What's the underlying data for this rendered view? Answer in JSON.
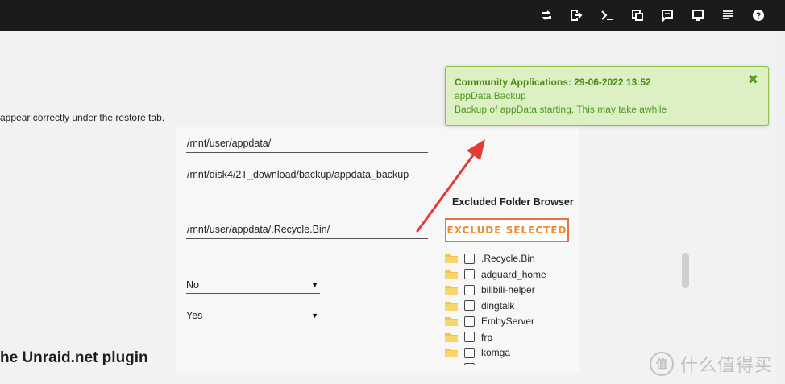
{
  "topbar": {
    "icons": [
      {
        "name": "swap-icon"
      },
      {
        "name": "logout-icon"
      },
      {
        "name": "terminal-icon"
      },
      {
        "name": "copy-icon"
      },
      {
        "name": "feedback-icon"
      },
      {
        "name": "monitor-icon"
      },
      {
        "name": "log-icon"
      },
      {
        "name": "help-icon",
        "glyph": "?"
      }
    ]
  },
  "main": {
    "subtitle": "appear correctly under the restore tab.",
    "appdata_path": "/mnt/user/appdata/",
    "backup_destination": "/mnt/disk4/2T_download/backup/appdata_backup",
    "excluded_folders": "/mnt/user/appdata/.Recycle.Bin/",
    "select_one": "No",
    "select_two": "Yes",
    "section_heading": "he Unraid.net plugin"
  },
  "folder_browser": {
    "title": "Excluded Folder Browser",
    "exclude_button": "EXCLUDE SELECTED",
    "folders": [
      ".Recycle.Bin",
      "adguard_home",
      "bilibili-helper",
      "dingtalk",
      "EmbyServer",
      "frp",
      "komga"
    ]
  },
  "toast": {
    "title": "Community Applications: 29-06-2022 13:52",
    "line1": "appData Backup",
    "line2": "Backup of appData starting. This may take awhile",
    "close_glyph": "✖",
    "color": "#dcf0c4"
  },
  "annotation": {
    "arrow_color": "#e53935"
  },
  "watermark": {
    "logo": "值",
    "text": "什么值得买"
  }
}
